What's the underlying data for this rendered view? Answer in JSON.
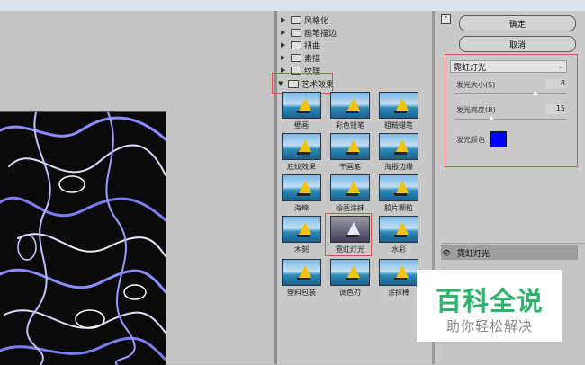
{
  "categories": [
    {
      "label": "风格化",
      "arrow": "▶"
    },
    {
      "label": "画笔描边",
      "arrow": "▶"
    },
    {
      "label": "扭曲",
      "arrow": "▶"
    },
    {
      "label": "素描",
      "arrow": "▶"
    },
    {
      "label": "纹理",
      "arrow": "▶"
    },
    {
      "label": "艺术效果",
      "arrow": "▼"
    }
  ],
  "filters": [
    {
      "label": "壁画"
    },
    {
      "label": "彩色铅笔"
    },
    {
      "label": "粗糙蜡笔"
    },
    {
      "label": "底纹效果"
    },
    {
      "label": "干画笔"
    },
    {
      "label": "海报边缘"
    },
    {
      "label": "海绵"
    },
    {
      "label": "绘画涂抹"
    },
    {
      "label": "胶片颗粒"
    },
    {
      "label": "木刻"
    },
    {
      "label": "霓虹灯光"
    },
    {
      "label": "水彩"
    },
    {
      "label": "塑料包装"
    },
    {
      "label": "调色刀"
    },
    {
      "label": "涂抹棒"
    }
  ],
  "buttons": {
    "ok": "确定",
    "cancel": "取消"
  },
  "effect_select": {
    "value": "霓虹灯光"
  },
  "params": {
    "size_label": "发光大小(S)",
    "size_value": "8",
    "brightness_label": "发光亮度(B)",
    "brightness_value": "15",
    "color_label": "发光颜色",
    "color_hex": "#0000ff"
  },
  "layers": {
    "name": "霓虹灯光"
  },
  "watermark": {
    "title": "百科全说",
    "subtitle": "助你轻松解决"
  }
}
